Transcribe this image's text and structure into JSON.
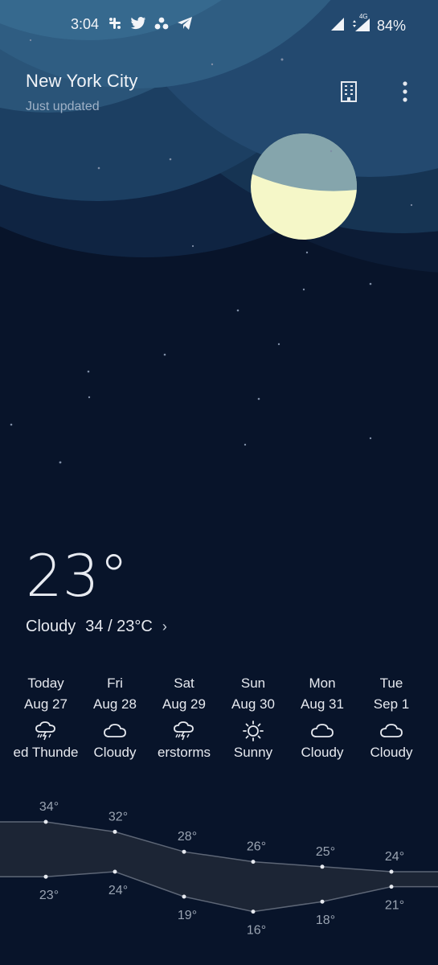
{
  "status_bar": {
    "time": "3:04",
    "network": "4G",
    "battery": "84%",
    "notification_icons": [
      "slack-icon",
      "twitter-icon",
      "asana-icon",
      "telegram-icon"
    ]
  },
  "location": {
    "city": "New York City",
    "updated": "Just updated"
  },
  "current": {
    "temperature": "23°",
    "condition": "Cloudy",
    "high_low": "34 / 23°C",
    "chevron": "›"
  },
  "forecast": {
    "days": [
      {
        "name": "Today",
        "date": "Aug 27",
        "icon": "thunderstorm-icon",
        "condition": "ed Thunde"
      },
      {
        "name": "Fri",
        "date": "Aug 28",
        "icon": "cloud-icon",
        "condition": "Cloudy"
      },
      {
        "name": "Sat",
        "date": "Aug 29",
        "icon": "thunderstorm-icon",
        "condition": "erstorms"
      },
      {
        "name": "Sun",
        "date": "Aug 30",
        "icon": "sun-icon",
        "condition": "Sunny"
      },
      {
        "name": "Mon",
        "date": "Aug 31",
        "icon": "cloud-icon",
        "condition": "Cloudy"
      },
      {
        "name": "Tue",
        "date": "Sep 1",
        "icon": "cloud-icon",
        "condition": "Cloudy"
      }
    ]
  },
  "chart_data": {
    "type": "area",
    "highs": [
      34,
      32,
      28,
      26,
      25,
      24
    ],
    "lows": [
      23,
      24,
      19,
      16,
      18,
      21
    ],
    "high_labels": [
      "34°",
      "32°",
      "28°",
      "26°",
      "25°",
      "24°"
    ],
    "low_labels": [
      "23°",
      "24°",
      "19°",
      "16°",
      "18°",
      "21°"
    ]
  },
  "colors": {
    "background": "#08142a",
    "moon": "#f5f7c8",
    "text": "#e6e9ef",
    "muted": "#9aa4b2"
  }
}
